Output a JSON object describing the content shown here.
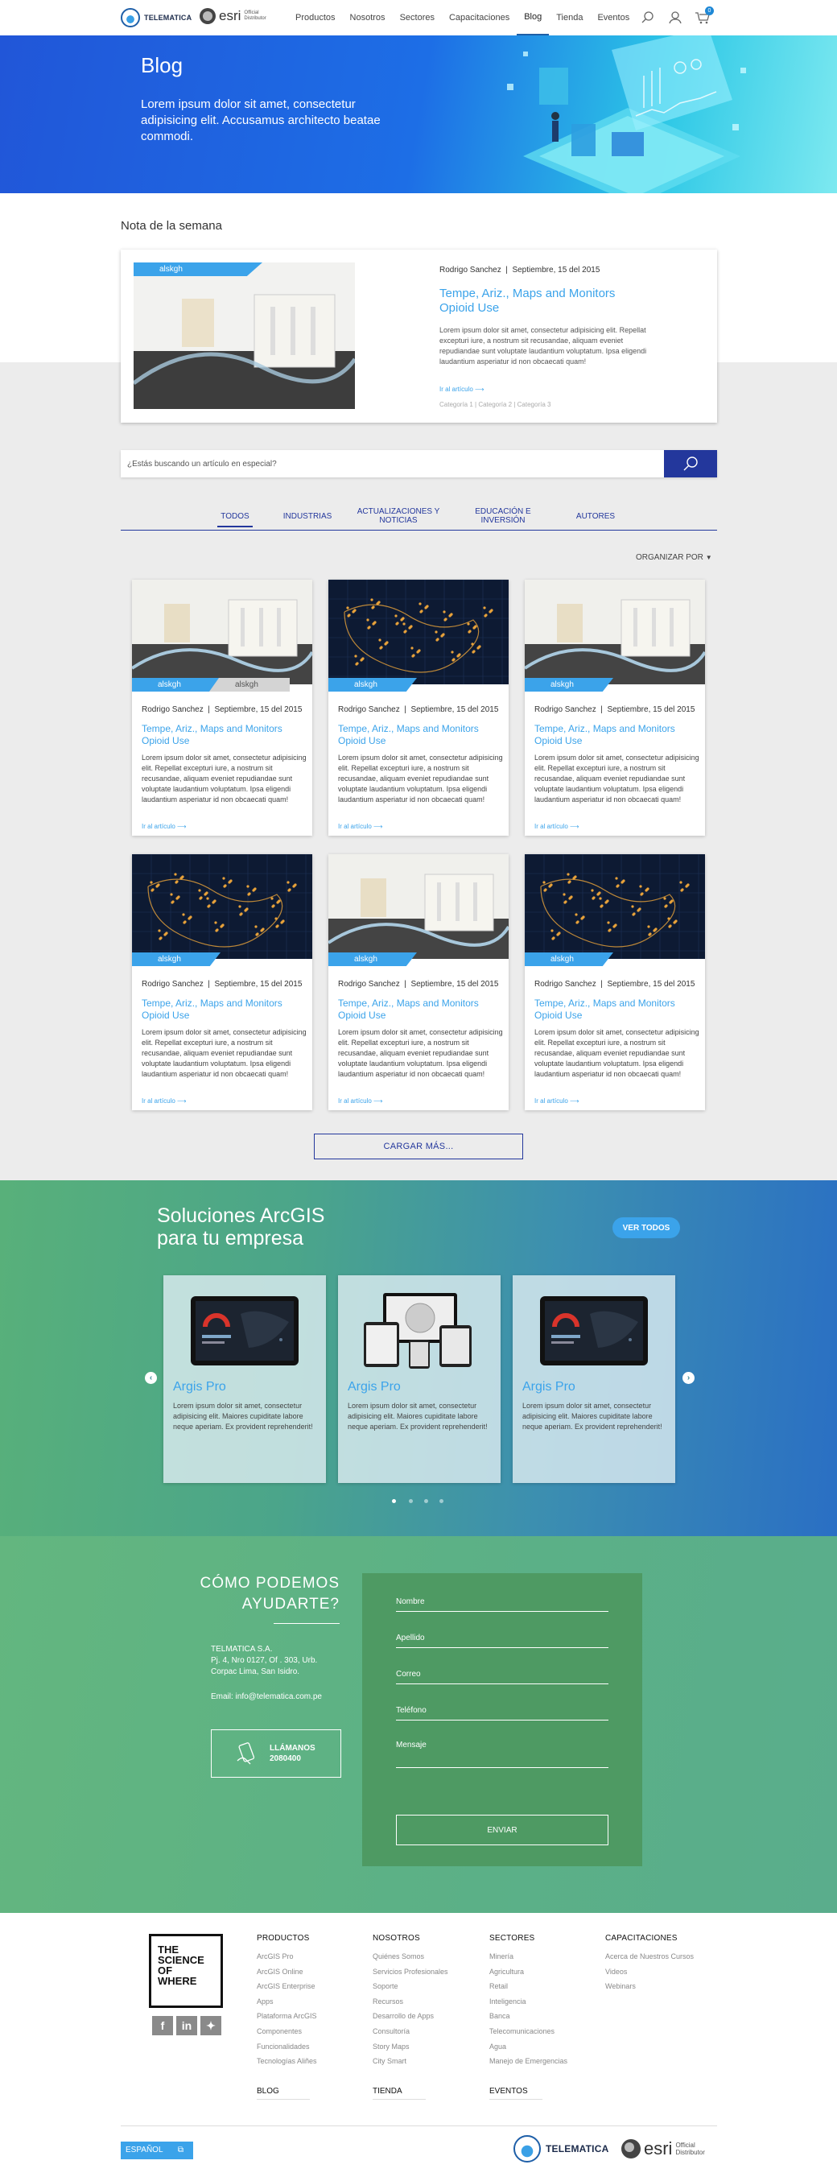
{
  "nav": {
    "brand": "TELEMATICA",
    "esri": "esri",
    "esri_sub1": "Official",
    "esri_sub2": "Distributor",
    "links": [
      "Productos",
      "Nosotros",
      "Sectores",
      "Capacitaciones",
      "Blog",
      "Tienda",
      "Eventos"
    ],
    "active": "Blog",
    "cart_count": "0"
  },
  "hero": {
    "title": "Blog",
    "subtitle": "Lorem ipsum dolor sit amet, consectetur adipisicing elit. Accusamus architecto beatae commodi."
  },
  "nota": {
    "section_title": "Nota de la semana",
    "tag": "alskgh",
    "author": "Rodrigo Sanchez",
    "date": "Septiembre, 15 del 2015",
    "title": "Tempe, Ariz., Maps and Monitors Opioid Use",
    "body": "Lorem ipsum dolor sit amet, consectetur adipisicing elit. Repellat excepturi iure, a nostrum sit recusandae, aliquam eveniet repudiandae sunt voluptate laudantium voluptatum. Ipsa eligendi laudantium asperiatur id non obcaecati quam!",
    "readmore": "Ir al artículo",
    "categories": "Categoría 1  |  Categoría 2  |  Categoría 3"
  },
  "search": {
    "placeholder": "¿Estás buscando un artículo en especial?"
  },
  "tabs": [
    "TODOS",
    "INDUSTRIAS",
    "ACTUALIZACIONES Y NOTICIAS",
    "EDUCACIÓN E INVERSIÓN",
    "AUTORES"
  ],
  "organize": "ORGANIZAR POR",
  "cards": [
    {
      "img": "lab",
      "tags": [
        "alskgh",
        "alskgh"
      ],
      "author": "Rodrigo Sanchez",
      "date": "Septiembre, 15 del 2015",
      "title": "Tempe, Ariz., Maps and Monitors Opioid Use",
      "body": "Lorem ipsum dolor sit amet, consectetur adipisicing elit. Repellat excepturi iure, a nostrum sit recusandae, aliquam eveniet repudiandae sunt voluptate laudantium voluptatum. Ipsa eligendi laudantium asperiatur id non obcaecati quam!",
      "readmore": "Ir al artículo"
    },
    {
      "img": "map",
      "tags": [
        "alskgh"
      ],
      "author": "Rodrigo Sanchez",
      "date": "Septiembre, 15 del 2015",
      "title": "Tempe, Ariz., Maps and Monitors Opioid Use",
      "body": "Lorem ipsum dolor sit amet, consectetur adipisicing elit. Repellat excepturi iure, a nostrum sit recusandae, aliquam eveniet repudiandae sunt voluptate laudantium voluptatum. Ipsa eligendi laudantium asperiatur id non obcaecati quam!",
      "readmore": "Ir al artículo"
    },
    {
      "img": "lab",
      "tags": [
        "alskgh"
      ],
      "author": "Rodrigo Sanchez",
      "date": "Septiembre, 15 del 2015",
      "title": "Tempe, Ariz., Maps and Monitors Opioid Use",
      "body": "Lorem ipsum dolor sit amet, consectetur adipisicing elit. Repellat excepturi iure, a nostrum sit recusandae, aliquam eveniet repudiandae sunt voluptate laudantium voluptatum. Ipsa eligendi laudantium asperiatur id non obcaecati quam!",
      "readmore": "Ir al artículo"
    },
    {
      "img": "map",
      "tags": [
        "alskgh"
      ],
      "author": "Rodrigo Sanchez",
      "date": "Septiembre, 15 del 2015",
      "title": "Tempe, Ariz., Maps and Monitors Opioid Use",
      "body": "Lorem ipsum dolor sit amet, consectetur adipisicing elit. Repellat excepturi iure, a nostrum sit recusandae, aliquam eveniet repudiandae sunt voluptate laudantium voluptatum. Ipsa eligendi laudantium asperiatur id non obcaecati quam!",
      "readmore": "Ir al artículo"
    },
    {
      "img": "lab",
      "tags": [
        "alskgh"
      ],
      "author": "Rodrigo Sanchez",
      "date": "Septiembre, 15 del 2015",
      "title": "Tempe, Ariz., Maps and Monitors Opioid Use",
      "body": "Lorem ipsum dolor sit amet, consectetur adipisicing elit. Repellat excepturi iure, a nostrum sit recusandae, aliquam eveniet repudiandae sunt voluptate laudantium voluptatum. Ipsa eligendi laudantium asperiatur id non obcaecati quam!",
      "readmore": "Ir al artículo"
    },
    {
      "img": "map",
      "tags": [
        "alskgh"
      ],
      "author": "Rodrigo Sanchez",
      "date": "Septiembre, 15 del 2015",
      "title": "Tempe, Ariz., Maps and Monitors Opioid Use",
      "body": "Lorem ipsum dolor sit amet, consectetur adipisicing elit. Repellat excepturi iure, a nostrum sit recusandae, aliquam eveniet repudiandae sunt voluptate laudantium voluptatum. Ipsa eligendi laudantium asperiatur id non obcaecati quam!",
      "readmore": "Ir al artículo"
    }
  ],
  "load_more": "CARGAR MÁS...",
  "arcgis": {
    "title1": "Soluciones ArcGIS",
    "title2": "para tu empresa",
    "see_all": "VER TODOS",
    "items": [
      {
        "name": "Argis Pro",
        "desc": "Lorem ipsum dolor sit amet, consectetur adipisicing elit. Maiores cupiditate labore neque aperiam. Ex provident reprehenderit!",
        "shot": "tablet"
      },
      {
        "name": "Argis Pro",
        "desc": "Lorem ipsum dolor sit amet, consectetur adipisicing elit. Maiores cupiditate labore neque aperiam. Ex provident reprehenderit!",
        "shot": "devices"
      },
      {
        "name": "Argis Pro",
        "desc": "Lorem ipsum dolor sit amet, consectetur adipisicing elit. Maiores cupiditate labore neque aperiam. Ex provident reprehenderit!",
        "shot": "tablet"
      }
    ],
    "active_dot": 0
  },
  "contact": {
    "title1": "CÓMO PODEMOS",
    "title2": "AYUDARTE?",
    "company": "TELMATICA S.A.",
    "address1": "Pj. 4, Nro 0127, Of . 303, Urb.",
    "address2": "Corpac Lima, San Isidro.",
    "email": "Email: info@telematica.com.pe",
    "call_label": "LLÁMANOS",
    "call_number": "2080400",
    "fields": [
      "Nombre",
      "Apellido",
      "Correo",
      "Teléfono",
      "Mensaje"
    ],
    "submit": "ENVIAR"
  },
  "footer": {
    "sow": [
      "THE",
      "SCIENCE",
      "OF",
      "WHERE"
    ],
    "columns": [
      {
        "title": "PRODUCTOS",
        "items": [
          "ArcGIS Pro",
          "ArcGIS Online",
          "ArcGIS Enterprise",
          "Apps",
          "Plataforma ArcGIS",
          "Componentes",
          "Funcionalidades",
          "Tecnologías Aliñes"
        ]
      },
      {
        "title": "NOSOTROS",
        "items": [
          "Quiénes Somos",
          "Servicios Profesionales",
          "Soporte",
          "Recursos",
          "Desarrollo de Apps",
          "Consultoría",
          "Story Maps",
          "City Smart"
        ]
      },
      {
        "title": "SECTORES",
        "items": [
          "Minería",
          "Agricultura",
          "Retail",
          "Inteligencia",
          "Banca",
          "Telecomunicaciones",
          "Agua",
          "Manejo de Emergencias"
        ]
      },
      {
        "title": "CAPACITACIONES",
        "items": [
          "Acerca de Nuestros Cursos",
          "Videos",
          "Webinars"
        ]
      }
    ],
    "bottom_heads": [
      "BLOG",
      "TIENDA",
      "EVENTOS"
    ],
    "language": "ESPAÑOL",
    "brand": "TELEMATICA",
    "esri": "esri",
    "esri_sub1": "Official",
    "esri_sub2": "Distributor"
  }
}
